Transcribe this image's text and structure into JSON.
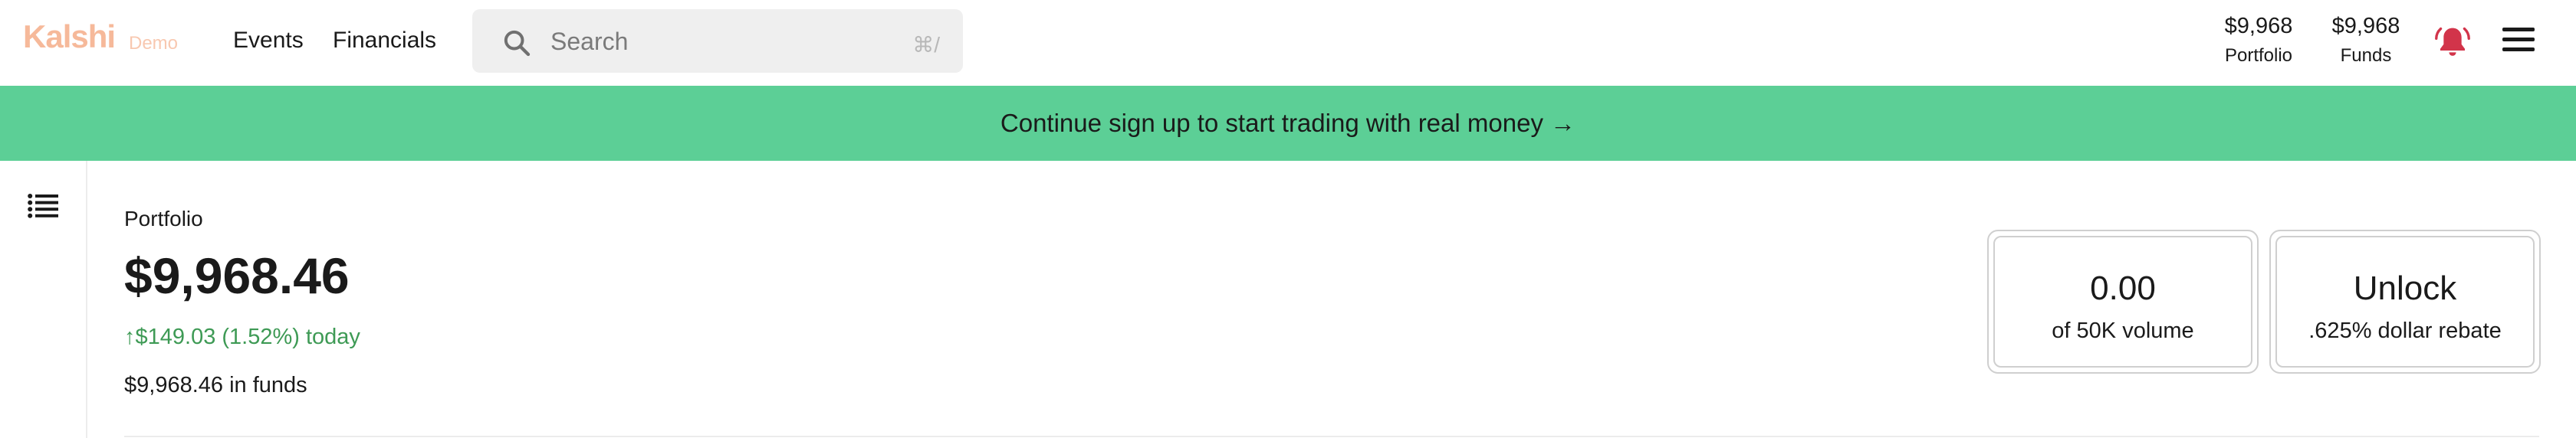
{
  "header": {
    "logo": "Kalshi",
    "badge": "Demo",
    "nav": [
      "Events",
      "Financials"
    ],
    "search": {
      "placeholder": "Search",
      "shortcut": "⌘/"
    },
    "portfolio": {
      "value": "$9,968",
      "label": "Portfolio"
    },
    "funds": {
      "value": "$9,968",
      "label": "Funds"
    },
    "icons": {
      "search": "search-icon",
      "bell": "bell-icon",
      "menu": "hamburger-menu-icon"
    },
    "colors": {
      "logo": "#f6b99a",
      "bell": "#d2344a"
    }
  },
  "banner": {
    "text": "Continue sign up to start trading with real money →",
    "color": "#5ccf96"
  },
  "sidebar": {
    "icon": "list-icon"
  },
  "portfolio": {
    "label": "Portfolio",
    "value": "$9,968.46",
    "change": "↑$149.03 (1.52%) today",
    "change_color": "#3e9a55",
    "funds": "$9,968.46 in funds"
  },
  "cards": [
    {
      "value": "0.00",
      "caption": "of 50K volume"
    },
    {
      "value": "Unlock",
      "caption": ".625% dollar rebate"
    }
  ]
}
